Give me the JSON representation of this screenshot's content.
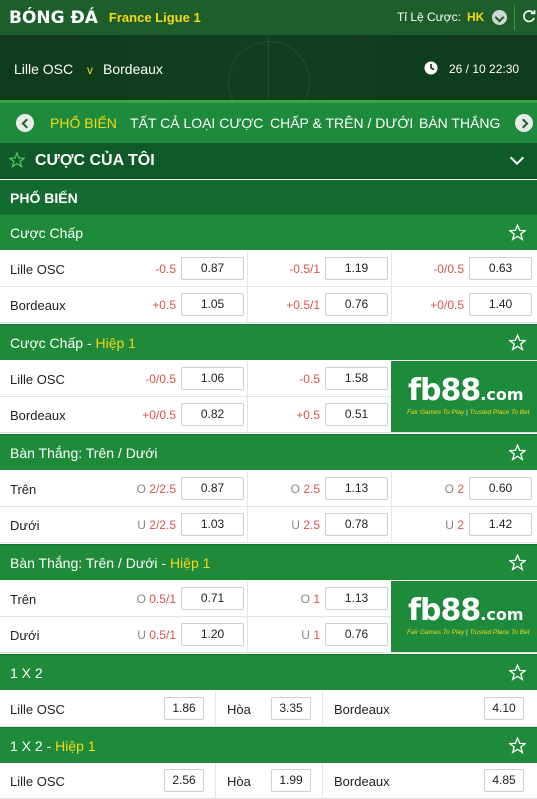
{
  "header": {
    "title": "BÓNG ĐÁ",
    "league": "France Ligue 1",
    "odds_label": "Tỉ Lệ Cược:",
    "odds_format": "HK"
  },
  "match": {
    "home": "Lille OSC",
    "vs": "v",
    "away": "Bordeaux",
    "datetime": "26 / 10  22:30"
  },
  "tabs": [
    "PHỔ BIẾN",
    "TẤT CẢ LOẠI CƯỢC",
    "CHẤP & TRÊN / DƯỚI",
    "BÀN THẮNG"
  ],
  "my_bets": "CƯỢC CỦA TÔI",
  "popular": "PHỔ BIẾN",
  "ad": {
    "brand": "fb88",
    "domain": ".com",
    "tag1": "Fair Games To Play",
    "tag2": "Trusted Place To Bet"
  },
  "markets": {
    "handicap": {
      "title": "Cược Chấp",
      "rows": [
        {
          "team": "Lille OSC",
          "lines": [
            [
              "-0.5",
              "0.87"
            ],
            [
              "-0.5/1",
              "1.19"
            ],
            [
              "-0/0.5",
              "0.63"
            ]
          ]
        },
        {
          "team": "Bordeaux",
          "lines": [
            [
              "+0.5",
              "1.05"
            ],
            [
              "+0.5/1",
              "0.76"
            ],
            [
              "+0/0.5",
              "1.40"
            ]
          ]
        }
      ]
    },
    "handicap_h1": {
      "title": "Cược Chấp",
      "suffix": "Hiệp 1",
      "rows": [
        {
          "team": "Lille OSC",
          "lines": [
            [
              "-0/0.5",
              "1.06"
            ],
            [
              "-0.5",
              "1.58"
            ]
          ]
        },
        {
          "team": "Bordeaux",
          "lines": [
            [
              "+0/0.5",
              "0.82"
            ],
            [
              "+0.5",
              "0.51"
            ]
          ]
        }
      ]
    },
    "ou": {
      "title": "Bàn Thắng: Trên / Dưới",
      "rows": [
        {
          "team": "Trên",
          "lines": [
            [
              "O",
              "2/2.5",
              "0.87"
            ],
            [
              "O",
              "2.5",
              "1.13"
            ],
            [
              "O",
              "2",
              "0.60"
            ]
          ]
        },
        {
          "team": "Dưới",
          "lines": [
            [
              "U",
              "2/2.5",
              "1.03"
            ],
            [
              "U",
              "2.5",
              "0.78"
            ],
            [
              "U",
              "2",
              "1.42"
            ]
          ]
        }
      ]
    },
    "ou_h1": {
      "title": "Bàn Thắng: Trên / Dưới",
      "suffix": "Hiệp 1",
      "rows": [
        {
          "team": "Trên",
          "lines": [
            [
              "O",
              "0.5/1",
              "0.71"
            ],
            [
              "O",
              "1",
              "1.13"
            ]
          ]
        },
        {
          "team": "Dưới",
          "lines": [
            [
              "U",
              "0.5/1",
              "1.20"
            ],
            [
              "U",
              "1",
              "0.76"
            ]
          ]
        }
      ]
    },
    "x12": {
      "title": "1 X 2",
      "row": {
        "home": "Lille OSC",
        "home_odds": "1.86",
        "draw": "Hòa",
        "draw_odds": "3.35",
        "away": "Bordeaux",
        "away_odds": "4.10"
      }
    },
    "x12_h1": {
      "title": "1 X 2",
      "suffix": "Hiệp 1",
      "row": {
        "home": "Lille OSC",
        "home_odds": "2.56",
        "draw": "Hòa",
        "draw_odds": "1.99",
        "away": "Bordeaux",
        "away_odds": "4.85"
      }
    }
  }
}
